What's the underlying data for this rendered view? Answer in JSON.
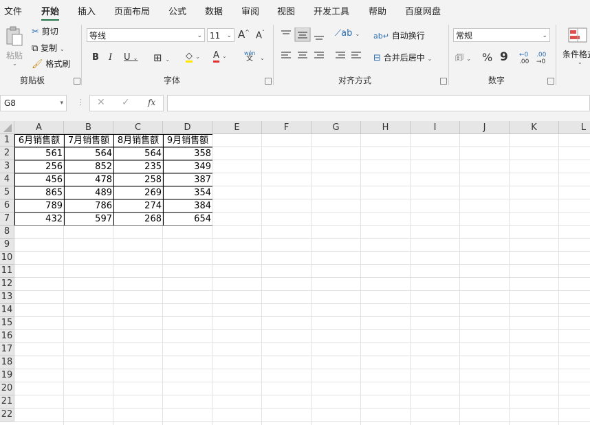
{
  "menu": [
    "文件",
    "开始",
    "插入",
    "页面布局",
    "公式",
    "数据",
    "审阅",
    "视图",
    "开发工具",
    "帮助",
    "百度网盘"
  ],
  "menu_active": "开始",
  "clipboard": {
    "paste": "粘贴",
    "cut": "剪切",
    "copy": "复制",
    "format_painter": "格式刷",
    "label": "剪贴板"
  },
  "font": {
    "name": "等线",
    "size": "11",
    "grow": "A",
    "shrink": "A",
    "bold": "B",
    "italic": "I",
    "underline": "U",
    "phonetic": "wén",
    "phonetic2": "文",
    "label": "字体"
  },
  "alignment": {
    "wrap": "自动换行",
    "merge": "合并后居中",
    "label": "对齐方式"
  },
  "number": {
    "format": "常规",
    "percent": "%",
    "comma": "9",
    "inc_dec": ".00",
    "label": "数字"
  },
  "styles": {
    "conditional": "条件格式"
  },
  "formula_bar": {
    "name_box": "G8",
    "cancel": "✕",
    "enter": "✓",
    "fx": "fx",
    "value": ""
  },
  "columns": [
    "A",
    "B",
    "C",
    "D",
    "E",
    "F",
    "G",
    "H",
    "I",
    "J",
    "K",
    "L"
  ],
  "rows": [
    "1",
    "2",
    "3",
    "4",
    "5",
    "6",
    "7",
    "8",
    "9",
    "10",
    "11",
    "12",
    "13",
    "14",
    "15",
    "16",
    "17",
    "18",
    "19",
    "20",
    "21",
    "22"
  ],
  "table": {
    "headers": [
      "6月销售额",
      "7月销售额",
      "8月销售额",
      "9月销售额"
    ],
    "rows": [
      [
        "561",
        "564",
        "564",
        "358"
      ],
      [
        "256",
        "852",
        "235",
        "349"
      ],
      [
        "456",
        "478",
        "258",
        "387"
      ],
      [
        "865",
        "489",
        "269",
        "354"
      ],
      [
        "789",
        "786",
        "274",
        "384"
      ],
      [
        "432",
        "597",
        "268",
        "654"
      ]
    ]
  },
  "colors": {
    "accent": "#217346",
    "font_color": "#e03030",
    "highlight": "#ffe500"
  }
}
